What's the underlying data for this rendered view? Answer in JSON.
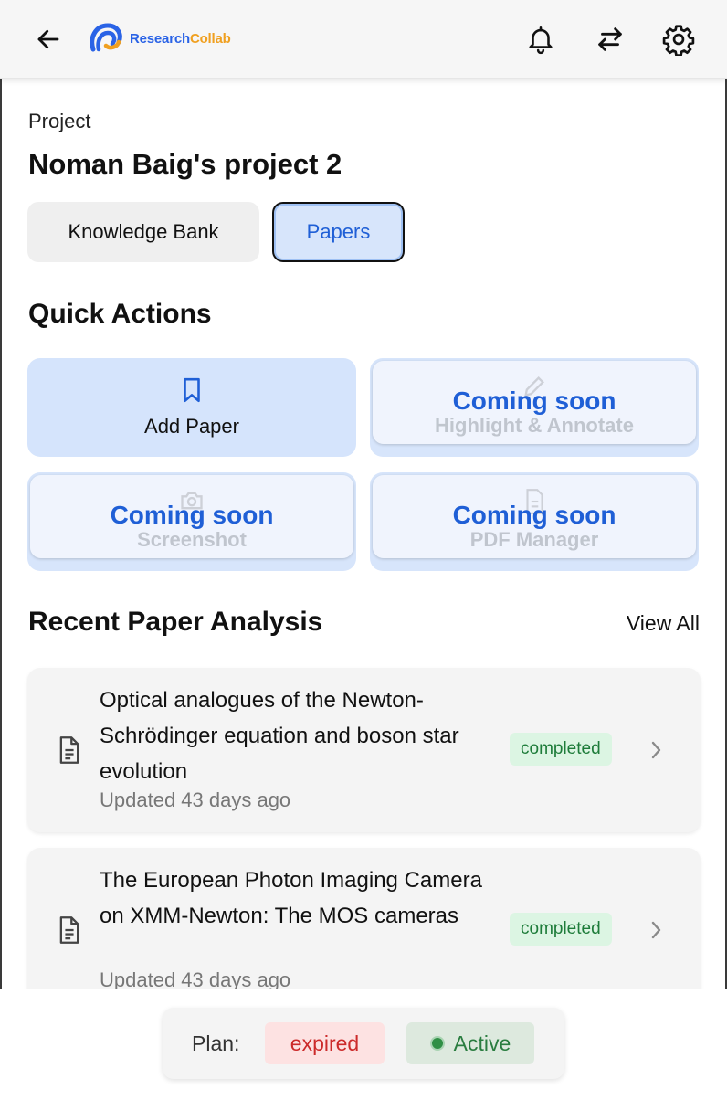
{
  "header": {
    "brand_part1": "Research",
    "brand_part2": "Collab",
    "icons": [
      "back-arrow-icon",
      "notifications-bell-icon",
      "swap-arrows-icon",
      "settings-gear-icon"
    ]
  },
  "project": {
    "label": "Project",
    "title": "Noman Baig's project 2"
  },
  "tabs": [
    {
      "label": "Knowledge Bank",
      "selected": false
    },
    {
      "label": "Papers",
      "selected": true
    }
  ],
  "quick_actions": {
    "title": "Quick Actions",
    "items": [
      {
        "label": "Add Paper",
        "icon": "bookmark-icon",
        "status": ""
      },
      {
        "label": "Highlight & Annotate",
        "icon": "pencil-icon",
        "status": "Coming soon"
      },
      {
        "label": "Screenshot",
        "icon": "camera-icon",
        "status": "Coming soon"
      },
      {
        "label": "PDF Manager",
        "icon": "file-icon",
        "status": "Coming soon"
      }
    ]
  },
  "recent_analysis": {
    "title": "Recent Paper Analysis",
    "view_all": "View All",
    "papers": [
      {
        "title": "Optical analogues of the Newton-Schrödinger equation and boson star evolution",
        "status": "completed",
        "updated": "Updated 43 days ago"
      },
      {
        "title": "The European Photon Imaging Camera on XMM-Newton: The MOS cameras",
        "status": "completed",
        "updated": "Updated 43 days ago"
      }
    ]
  },
  "plan": {
    "label": "Plan:",
    "status": "expired",
    "active_label": "Active"
  },
  "colors": {
    "accent_blue": "#1f5fd6",
    "card_blue": "#d5e4fc",
    "badge_green_bg": "#dcf5e3",
    "expired_red": "#cc2b2b",
    "active_green": "#2a7d40"
  }
}
